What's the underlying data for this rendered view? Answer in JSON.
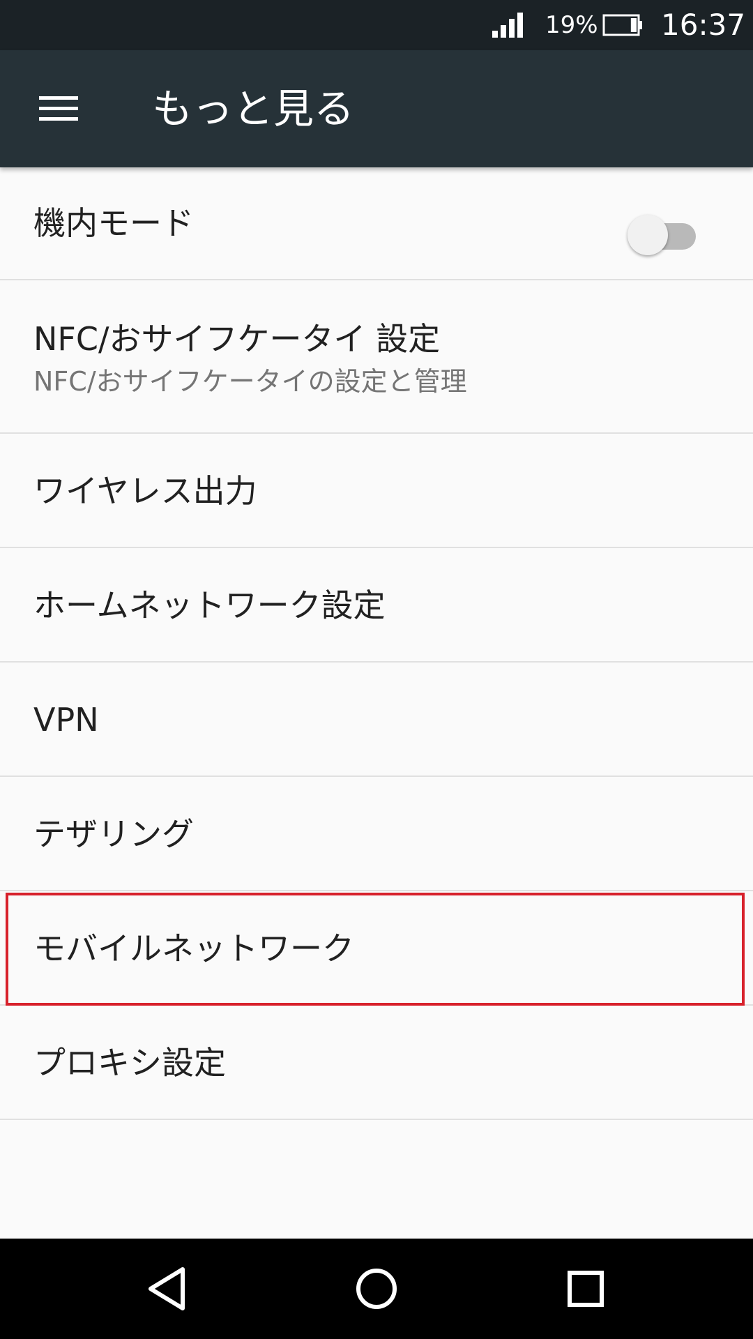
{
  "status_bar": {
    "battery_percent": "19%",
    "time": "16:37",
    "battery_level": 0.19,
    "signal_bars": 4,
    "icons": [
      "signal-icon",
      "battery-icon"
    ]
  },
  "app_bar": {
    "title": "もっと見る",
    "menu_icon": "hamburger-menu-icon"
  },
  "settings": {
    "airplane_mode": {
      "title": "機内モード",
      "toggle_on": false
    },
    "nfc": {
      "title": "NFC/おサイフケータイ 設定",
      "summary": "NFC/おサイフケータイの設定と管理"
    },
    "wireless_output": {
      "title": "ワイヤレス出力"
    },
    "home_network": {
      "title": "ホームネットワーク設定"
    },
    "vpn": {
      "title": "VPN"
    },
    "tethering": {
      "title": "テザリング"
    },
    "mobile_network": {
      "title": "モバイルネットワーク",
      "highlighted": true
    },
    "proxy": {
      "title": "プロキシ設定"
    }
  },
  "colors": {
    "app_bar": "#263238",
    "status_bar": "#1b2226",
    "highlight": "#d7212b",
    "background": "#fafafa"
  },
  "nav_bar": {
    "icons": [
      "back-icon",
      "home-icon",
      "recents-icon"
    ]
  }
}
